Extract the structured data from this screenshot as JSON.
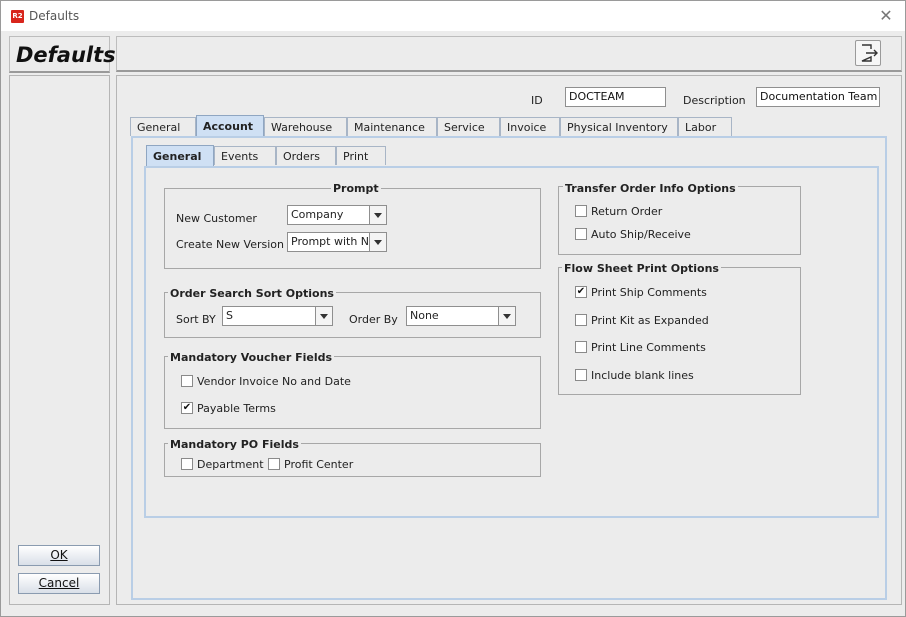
{
  "window": {
    "title": "Defaults",
    "app_icon_text": "R2"
  },
  "page": {
    "title": "Defaults"
  },
  "buttons": {
    "ok": "OK",
    "cancel": "Cancel"
  },
  "header": {
    "id_label": "ID",
    "id_value": "DOCTEAM",
    "description_label": "Description",
    "description_value": "Documentation Team"
  },
  "tabs": [
    "General",
    "Account",
    "Warehouse",
    "Maintenance",
    "Service",
    "Invoice",
    "Physical Inventory",
    "Labor"
  ],
  "active_tab": "Account",
  "subtabs": [
    "General",
    "Events",
    "Orders",
    "Print"
  ],
  "active_subtab": "General",
  "prompt": {
    "title": "Prompt",
    "new_customer_label": "New Customer",
    "new_customer_value": "Company",
    "create_new_version_label": "Create New Version",
    "create_new_version_value": "Prompt with No"
  },
  "order_search": {
    "title": "Order Search Sort Options",
    "sort_by_label": "Sort BY",
    "sort_by_value": "S",
    "order_by_label": "Order By",
    "order_by_value": "None"
  },
  "voucher": {
    "title": "Mandatory Voucher Fields",
    "vendor_invoice": {
      "label": "Vendor Invoice No and Date",
      "checked": false
    },
    "payable_terms": {
      "label": "Payable Terms",
      "checked": true
    }
  },
  "po_fields": {
    "title": "Mandatory PO Fields",
    "department": {
      "label": "Department",
      "checked": false
    },
    "profit_center": {
      "label": "Profit Center",
      "checked": false
    }
  },
  "transfer": {
    "title": "Transfer Order Info Options",
    "return_order": {
      "label": "Return Order",
      "checked": false
    },
    "auto_ship": {
      "label": "Auto Ship/Receive",
      "checked": false
    }
  },
  "flow_sheet": {
    "title": "Flow Sheet Print Options",
    "ship_comments": {
      "label": "Print Ship Comments",
      "checked": true
    },
    "kit_expanded": {
      "label": "Print Kit as Expanded",
      "checked": false
    },
    "line_comments": {
      "label": "Print Line Comments",
      "checked": false
    },
    "blank_lines": {
      "label": "Include blank lines",
      "checked": false
    }
  },
  "icons": {
    "close": "close-icon",
    "exit": "exit-icon",
    "dropdown": "chevron-down-icon",
    "checkmark": "checkmark-icon"
  },
  "colors": {
    "app_icon": "#d8251c",
    "active_tab": "#cfe0f4",
    "panel_border": "#b9cee6"
  }
}
